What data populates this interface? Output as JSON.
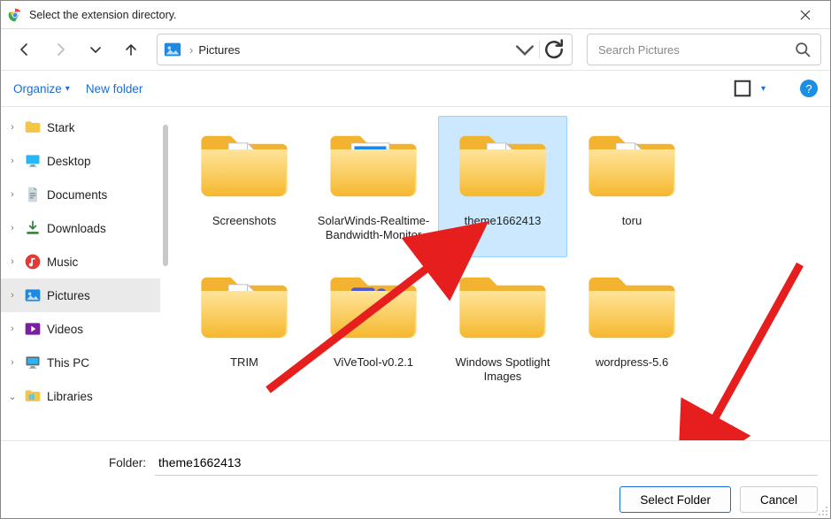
{
  "title": "Select the extension directory.",
  "breadcrumb": {
    "location": "Pictures"
  },
  "search": {
    "placeholder": "Search Pictures"
  },
  "toolbar": {
    "organize": "Organize",
    "newfolder": "New folder"
  },
  "sidebar": {
    "items": [
      {
        "label": "Stark",
        "icon": "folder",
        "expander": ">"
      },
      {
        "label": "Desktop",
        "icon": "desktop",
        "expander": ">"
      },
      {
        "label": "Documents",
        "icon": "documents",
        "expander": ">"
      },
      {
        "label": "Downloads",
        "icon": "downloads",
        "expander": ">"
      },
      {
        "label": "Music",
        "icon": "music",
        "expander": ">"
      },
      {
        "label": "Pictures",
        "icon": "pictures",
        "expander": ">",
        "active": true
      },
      {
        "label": "Videos",
        "icon": "videos",
        "expander": ">"
      },
      {
        "label": "This PC",
        "icon": "thispc",
        "expander": ">"
      },
      {
        "label": "Libraries",
        "icon": "libraries",
        "expander": "v"
      }
    ]
  },
  "folders": [
    {
      "label": "Screenshots",
      "variant": "doc"
    },
    {
      "label": "SolarWinds-Realtime-Bandwidth-Monitor",
      "variant": "img"
    },
    {
      "label": "theme1662413",
      "variant": "doc",
      "selected": true
    },
    {
      "label": "toru",
      "variant": "doc"
    },
    {
      "label": "TRIM",
      "variant": "doc"
    },
    {
      "label": "ViVeTool-v0.2.1",
      "variant": "teams"
    },
    {
      "label": "Windows Spotlight Images",
      "variant": "plain"
    },
    {
      "label": "wordpress-5.6",
      "variant": "plain"
    }
  ],
  "footer": {
    "label": "Folder:",
    "value": "theme1662413",
    "select": "Select Folder",
    "cancel": "Cancel"
  }
}
